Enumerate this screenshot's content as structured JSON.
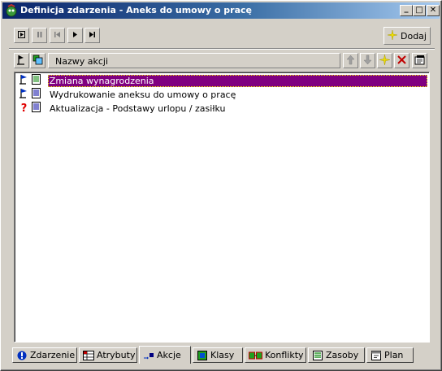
{
  "window": {
    "title": "Definicja zdarzenia - Aneks do umowy o pracę",
    "controls": {
      "minimize": "_",
      "maximize": "□",
      "close": "✕"
    }
  },
  "toolbar": {
    "add_label": "Dodaj",
    "media_icons": [
      "play-icon",
      "pause-icon",
      "step-back-icon",
      "step-forward-icon",
      "skip-end-icon"
    ]
  },
  "actions_panel": {
    "column_header": "Nazwy akcji",
    "items": [
      {
        "label": "Zmiana wynagrodzenia",
        "status_icon": "flag-icon",
        "selected": true
      },
      {
        "label": "Wydrukowanie aneksu do umowy o pracę",
        "status_icon": "flag-icon",
        "selected": false
      },
      {
        "label": "Aktualizacja - Podstawy urlopu / zasiłku",
        "status_icon": "question-icon",
        "selected": false
      }
    ]
  },
  "tabs": [
    {
      "label": "Zdarzenie",
      "icon": "exclamation-icon",
      "active": false
    },
    {
      "label": "Atrybuty",
      "icon": "attributes-icon",
      "active": false
    },
    {
      "label": "Akcje",
      "icon": "actions-icon",
      "active": true
    },
    {
      "label": "Klasy",
      "icon": "classes-icon",
      "active": false
    },
    {
      "label": "Konflikty",
      "icon": "conflicts-icon",
      "active": false
    },
    {
      "label": "Zasoby",
      "icon": "resources-icon",
      "active": false
    },
    {
      "label": "Plan",
      "icon": "plan-icon",
      "active": false
    }
  ],
  "colors": {
    "selection": "#800080",
    "titlebar_start": "#0a246a",
    "titlebar_end": "#a6caf0"
  }
}
